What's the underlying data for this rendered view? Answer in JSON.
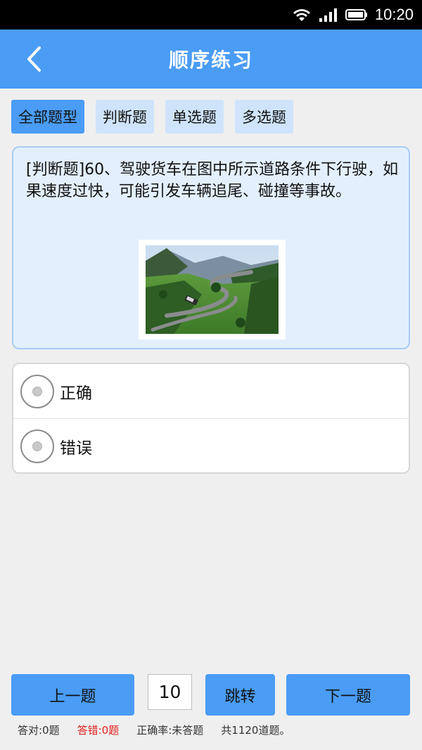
{
  "status_bar": {
    "time": "10:20",
    "icons": [
      "wifi-icon",
      "signal-icon",
      "battery-icon"
    ]
  },
  "app_bar": {
    "back_icon": "chevron-left-icon",
    "title": "顺序练习"
  },
  "tabs": [
    {
      "label": "全部题型",
      "active": true
    },
    {
      "label": "判断题",
      "active": false
    },
    {
      "label": "单选题",
      "active": false
    },
    {
      "label": "多选题",
      "active": false
    }
  ],
  "question": {
    "text": "[判断题]60、驾驶货车在图中所示道路条件下行驶，如果速度过快，可能引发车辆追尾、碰撞等事故。",
    "image": "mountain-road-truck-image"
  },
  "options": [
    {
      "label": "正确"
    },
    {
      "label": "错误"
    }
  ],
  "navigation": {
    "prev_label": "上一题",
    "page_value": "10",
    "jump_label": "跳转",
    "next_label": "下一题"
  },
  "stats": {
    "correct": "答对:0题",
    "wrong": "答错:0题",
    "accuracy": "正确率:未答题",
    "total": "共1120道题。"
  },
  "colors": {
    "accent": "#4a9cf5",
    "tab_inactive": "#cfe4fb",
    "card_bg": "#e3effd",
    "card_border": "#a9cdf3",
    "wrong_text": "#e02020",
    "page_bg": "#efefef"
  }
}
